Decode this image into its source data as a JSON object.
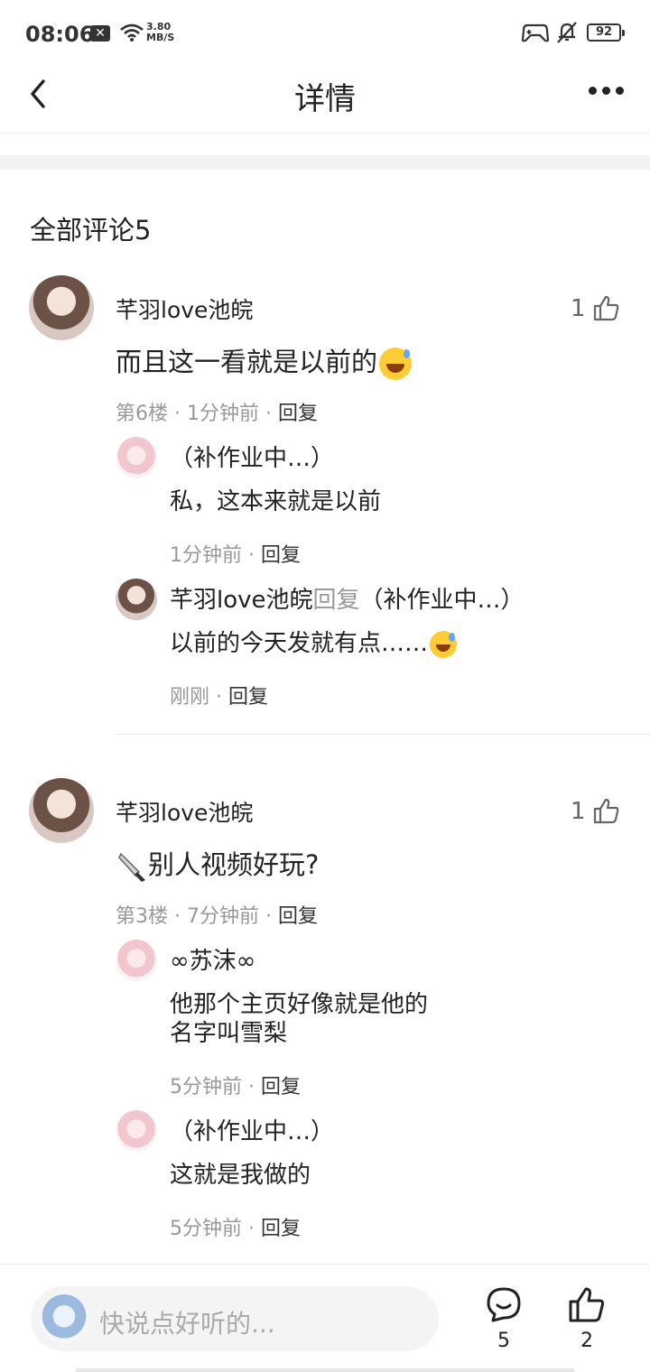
{
  "status_bar": {
    "time": "08:06",
    "speed_value": "3.80",
    "speed_unit": "MB/S",
    "battery": "92"
  },
  "header": {
    "title": "详情"
  },
  "comments_section": {
    "title": "全部评论5"
  },
  "comments": [
    {
      "user": "芊羽love池皖",
      "text": "而且这一看就是以前的",
      "floor": "第6楼",
      "time": "1分钟前",
      "reply_label": "回复",
      "likes": "1",
      "replies": [
        {
          "user": "（补作业中…）",
          "text": "私，这本来就是以前",
          "time": "1分钟前",
          "reply_label": "回复"
        },
        {
          "user": "芊羽love池皖",
          "reply_word": "回复",
          "reply_to": "（补作业中…）",
          "text": "以前的今天发就有点……",
          "time": "刚刚",
          "reply_label": "回复"
        }
      ]
    },
    {
      "user": "芊羽love池皖",
      "text": "别人视频好玩?",
      "floor": "第3楼",
      "time": "7分钟前",
      "reply_label": "回复",
      "likes": "1",
      "replies": [
        {
          "user": "∞苏沫∞",
          "text_line1": "他那个主页好像就是他的",
          "text_line2": "名字叫雪梨",
          "time": "5分钟前",
          "reply_label": "回复"
        },
        {
          "user": "（补作业中…）",
          "text": "这就是我做的",
          "time": "5分钟前",
          "reply_label": "回复"
        }
      ]
    }
  ],
  "bottom_bar": {
    "placeholder": "快说点好听的...",
    "comment_count": "5",
    "like_count": "2"
  },
  "icons": [
    "back-arrow-icon",
    "more-dots-icon",
    "thumb-up-icon",
    "comment-bubble-icon",
    "wifi-icon",
    "gamepad-icon",
    "bell-muted-icon",
    "knife-icon",
    "sweat-smile-emoji"
  ]
}
